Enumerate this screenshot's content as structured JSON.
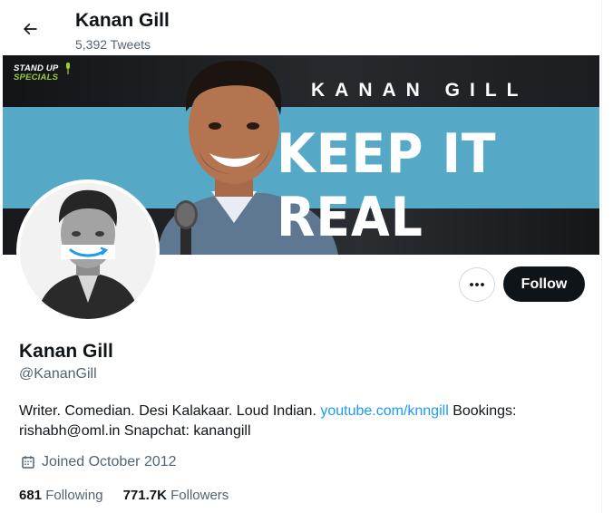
{
  "header": {
    "title": "Kanan Gill",
    "tweet_count": "5,392 Tweets"
  },
  "banner": {
    "logo_line1": "STAND UP",
    "logo_line2": "SPECIALS",
    "name_text": "KANAN GILL",
    "tagline": "KEEP IT REAL"
  },
  "actions": {
    "follow_label": "Follow"
  },
  "profile": {
    "name": "Kanan Gill",
    "handle": "@KananGill",
    "bio_before_link": "Writer. Comedian. Desi Kalakaar. Loud Indian. ",
    "bio_link": "youtube.com/knngill",
    "bio_after_link": " Bookings: rishabh@oml.in Snapchat: kanangill",
    "joined": "Joined October 2012",
    "following_count": "681",
    "following_label": "Following",
    "followers_count": "771.7K",
    "followers_label": "Followers"
  },
  "colors": {
    "link": "#1d9bf0",
    "secondary_text": "#536471",
    "follow_bg": "#0f1419",
    "banner_stripe": "#56a9c6"
  },
  "icons": [
    "back-arrow-icon",
    "more-icon",
    "calendar-icon",
    "microphone-icon"
  ]
}
